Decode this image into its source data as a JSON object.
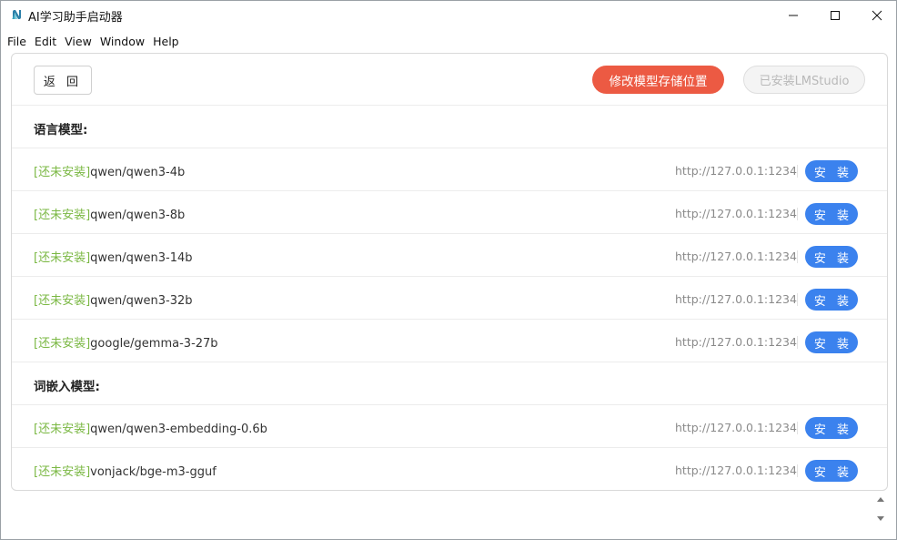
{
  "window": {
    "title": "AI学习助手启动器",
    "app_icon": "app-logo-icon",
    "controls": [
      "minimize-icon",
      "maximize-icon",
      "close-icon"
    ]
  },
  "menu": {
    "items": [
      "File",
      "Edit",
      "Window",
      "Help"
    ],
    "view": "View"
  },
  "toolbar": {
    "back_label": "返 回",
    "modify_label": "修改模型存储位置",
    "installed_label": "已安装LMStudio"
  },
  "colors": {
    "accent_red": "#ec5a43",
    "accent_blue": "#3b82ee",
    "status_green": "#7bb844"
  },
  "sections": {
    "language": {
      "title": "语言模型:",
      "rows": [
        {
          "status": "[还未安装]",
          "model": "qwen/qwen3-4b",
          "url": "http://127.0.0.1:1234",
          "action": "安 装"
        },
        {
          "status": "[还未安装]",
          "model": "qwen/qwen3-8b",
          "url": "http://127.0.0.1:1234",
          "action": "安 装"
        },
        {
          "status": "[还未安装]",
          "model": "qwen/qwen3-14b",
          "url": "http://127.0.0.1:1234",
          "action": "安 装"
        },
        {
          "status": "[还未安装]",
          "model": "qwen/qwen3-32b",
          "url": "http://127.0.0.1:1234",
          "action": "安 装"
        },
        {
          "status": "[还未安装]",
          "model": "google/gemma-3-27b",
          "url": "http://127.0.0.1:1234",
          "action": "安 装"
        }
      ]
    },
    "embedding": {
      "title": "词嵌入模型:",
      "rows": [
        {
          "status": "[还未安装]",
          "model": "qwen/qwen3-embedding-0.6b",
          "url": "http://127.0.0.1:1234",
          "action": "安 装"
        },
        {
          "status": "[还未安装]",
          "model": "vonjack/bge-m3-gguf",
          "url": "http://127.0.0.1:1234",
          "action": "安 装"
        }
      ]
    }
  }
}
